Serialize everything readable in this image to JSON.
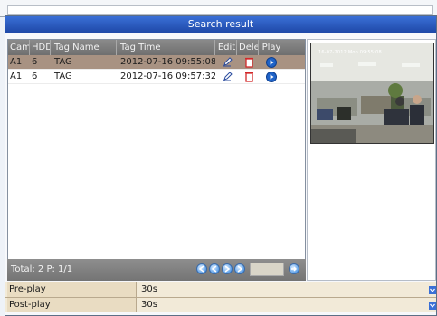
{
  "dialog": {
    "title": "Search result"
  },
  "table": {
    "headers": {
      "camera": "Camera",
      "hdd": "HDD",
      "tag_name": "Tag Name",
      "tag_time": "Tag Time",
      "edit": "Edit",
      "delete": "Delete",
      "play": "Play"
    },
    "rows": [
      {
        "camera": "A1",
        "hdd": "6",
        "tag_name": "TAG",
        "tag_time": "2012-07-16 09:55:08",
        "selected": true
      },
      {
        "camera": "A1",
        "hdd": "6",
        "tag_name": "TAG",
        "tag_time": "2012-07-16 09:57:32",
        "selected": false
      }
    ]
  },
  "footer": {
    "total_text": "Total: 2  P: 1/1",
    "page_input": ""
  },
  "preview": {
    "osd": "16-07-2012 Mon 09:55:08"
  },
  "params": [
    {
      "label": "Pre-play",
      "value": "30s"
    },
    {
      "label": "Post-play",
      "value": "30s"
    }
  ],
  "icons": {
    "edit": "pencil-icon",
    "delete": "trash-icon",
    "play": "play-icon",
    "nav": [
      "first-page-icon",
      "prev-page-icon",
      "next-page-icon",
      "last-page-icon",
      "go-icon"
    ]
  }
}
